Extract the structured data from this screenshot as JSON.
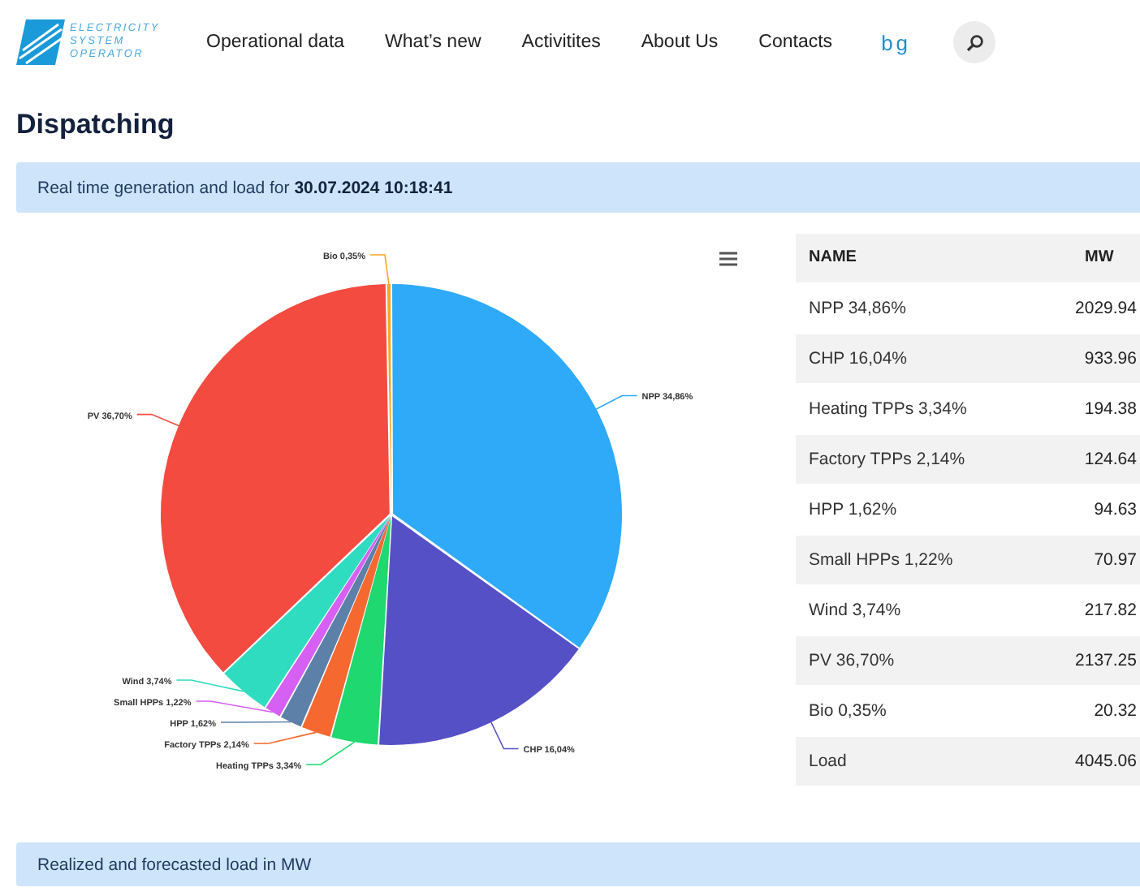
{
  "header": {
    "logo_lines": [
      "ELECTRICITY",
      "SYSTEM",
      "OPERATOR"
    ],
    "nav": [
      "Operational data",
      "What’s new",
      "Activitites",
      "About Us",
      "Contacts"
    ],
    "language": "bg"
  },
  "page_title": "Dispatching",
  "realtime_banner": {
    "text": "Real time generation and load for",
    "timestamp": "30.07.2024 10:18:41"
  },
  "chart": {
    "chart_data": {
      "type": "pie",
      "categories": [
        "NPP",
        "CHP",
        "Heating TPPs",
        "Factory TPPs",
        "HPP",
        "Small HPPs",
        "Wind",
        "PV",
        "Bio"
      ],
      "values": [
        34.86,
        16.04,
        3.34,
        2.14,
        1.62,
        1.22,
        3.74,
        36.7,
        0.35
      ],
      "colors": [
        "#2eaaf8",
        "#5650c6",
        "#1fd86f",
        "#f5682f",
        "#5c80a8",
        "#d560f3",
        "#30dcc0",
        "#f44b40",
        "#f5a623"
      ],
      "value_labels": [
        "34,86%",
        "16,04%",
        "3,34%",
        "2,14%",
        "1,62%",
        "1,22%",
        "3,74%",
        "36,70%",
        "0,35%"
      ]
    }
  },
  "table": {
    "columns": [
      "NAME",
      "MW"
    ],
    "rows": [
      {
        "name": "NPP 34,86%",
        "mw": "2029.94"
      },
      {
        "name": "CHP 16,04%",
        "mw": "933.96"
      },
      {
        "name": "Heating TPPs 3,34%",
        "mw": "194.38"
      },
      {
        "name": "Factory TPPs 2,14%",
        "mw": "124.64"
      },
      {
        "name": "HPP 1,62%",
        "mw": "94.63"
      },
      {
        "name": "Small HPPs 1,22%",
        "mw": "70.97"
      },
      {
        "name": "Wind 3,74%",
        "mw": "217.82"
      },
      {
        "name": "PV 36,70%",
        "mw": "2137.25"
      },
      {
        "name": "Bio 0,35%",
        "mw": "20.32"
      },
      {
        "name": "Load",
        "mw": "4045.06"
      }
    ]
  },
  "load_banner": {
    "text": "Realized and forecasted load in MW"
  }
}
